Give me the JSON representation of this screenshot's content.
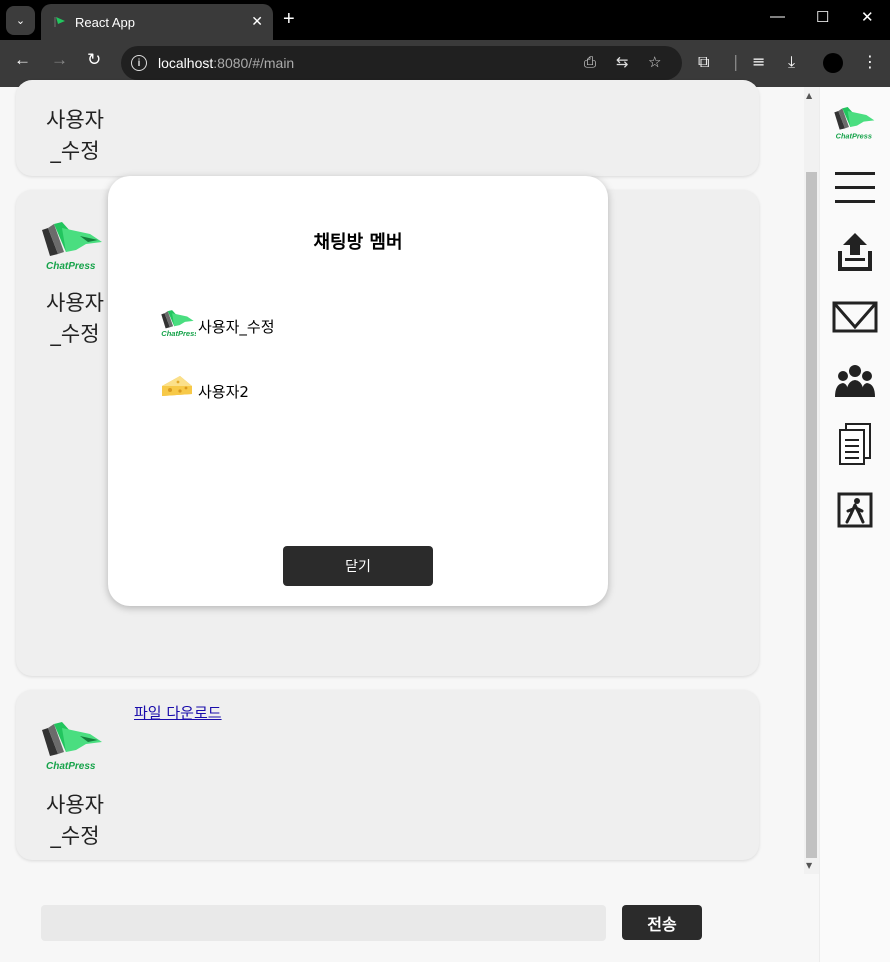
{
  "browser": {
    "tab_title": "React App",
    "url_host": "localhost",
    "url_rest": ":8080/#/main"
  },
  "messages": [
    {
      "sender": "사용자\n_수정"
    },
    {
      "sender": "사용자\n_수정"
    },
    {
      "sender": "사용자\n_수정",
      "link": "파일 다운로드"
    }
  ],
  "logo_text": "ChatPress",
  "composer": {
    "send_label": "전송"
  },
  "modal": {
    "title": "채팅방 멤버",
    "members": [
      {
        "name": "사용자_수정",
        "avatar": "chatpress-logo"
      },
      {
        "name": "사용자2",
        "avatar": "cheese-icon"
      }
    ],
    "close_label": "닫기"
  },
  "sidebar": {
    "items": [
      "chatpress-logo",
      "menu-icon",
      "upload-icon",
      "mail-icon",
      "members-icon",
      "document-icon",
      "exit-icon"
    ]
  },
  "colors": {
    "accent_green": "#22c55e",
    "dark_button": "#2b2b2b",
    "card_bg": "#efefef"
  }
}
